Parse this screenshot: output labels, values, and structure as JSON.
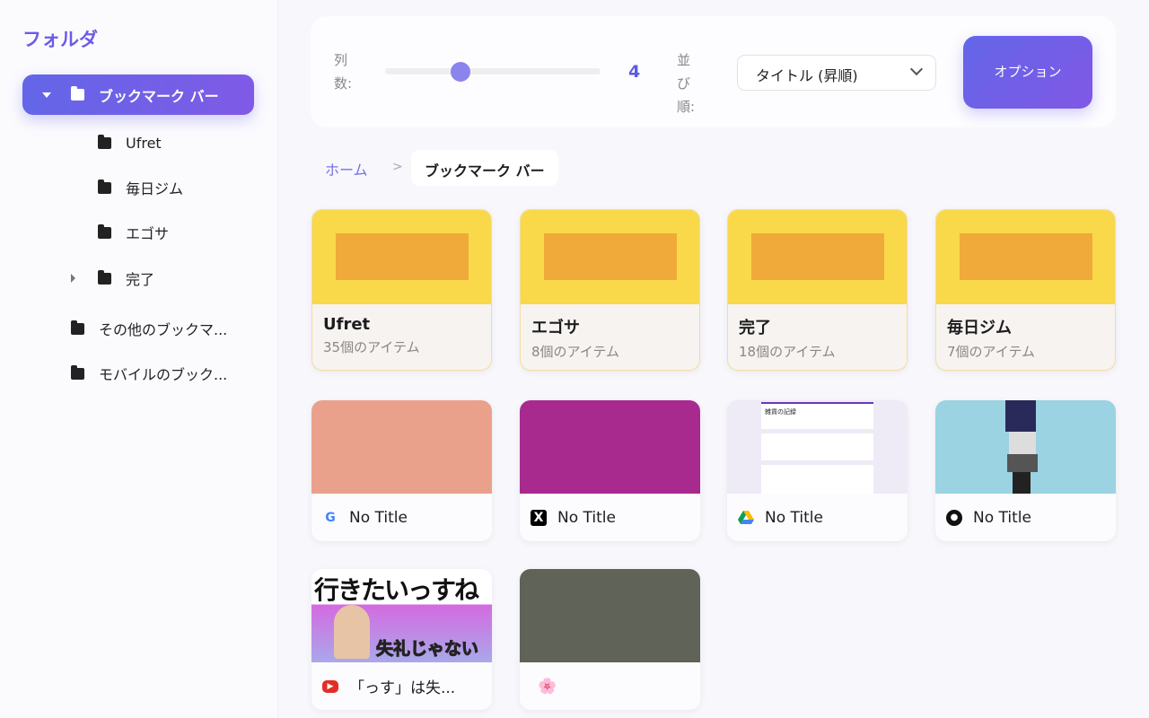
{
  "sidebar": {
    "title": "フォルダ",
    "items": [
      {
        "label": "ブックマーク バー",
        "expanded": true,
        "active": true
      },
      {
        "label": "Ufret"
      },
      {
        "label": "毎日ジム"
      },
      {
        "label": "エゴサ"
      },
      {
        "label": "完了",
        "collapsed": true
      },
      {
        "label": "その他のブックマ..."
      },
      {
        "label": "モバイルのブック..."
      }
    ]
  },
  "toolbar": {
    "columns_label": "列数:",
    "columns_value": "4",
    "columns_slider": {
      "min": 1,
      "max": 8,
      "value": 4
    },
    "sort_label": "並び順:",
    "sort_value": "タイトル (昇順)",
    "options_label": "オプション"
  },
  "breadcrumb": {
    "home": "ホーム",
    "separator": ">",
    "current": "ブックマーク バー"
  },
  "folders": [
    {
      "title": "Ufret",
      "count": "35個のアイテム"
    },
    {
      "title": "エゴサ",
      "count": "8個のアイテム"
    },
    {
      "title": "完了",
      "count": "18個のアイテム"
    },
    {
      "title": "毎日ジム",
      "count": "7個のアイテム"
    }
  ],
  "links": [
    {
      "title": "No Title",
      "icon": "google-icon",
      "thumb_color": "#eaa18c"
    },
    {
      "title": "No Title",
      "icon": "x-icon",
      "thumb_color": "#a92a8f"
    },
    {
      "title": "No Title",
      "icon": "google-drive-icon",
      "thumb_text": "雑貨の記録"
    },
    {
      "title": "No Title",
      "icon": "github-icon",
      "thumb_color": "#9bd3e2"
    },
    {
      "title": "「っす」は失...",
      "icon": "youtube-icon",
      "thumb_text": "行きたいっすね",
      "thumb_text2": "失礼じゃない"
    },
    {
      "title": "🌸",
      "icon": "",
      "thumb_color": "#5f6358"
    }
  ]
}
